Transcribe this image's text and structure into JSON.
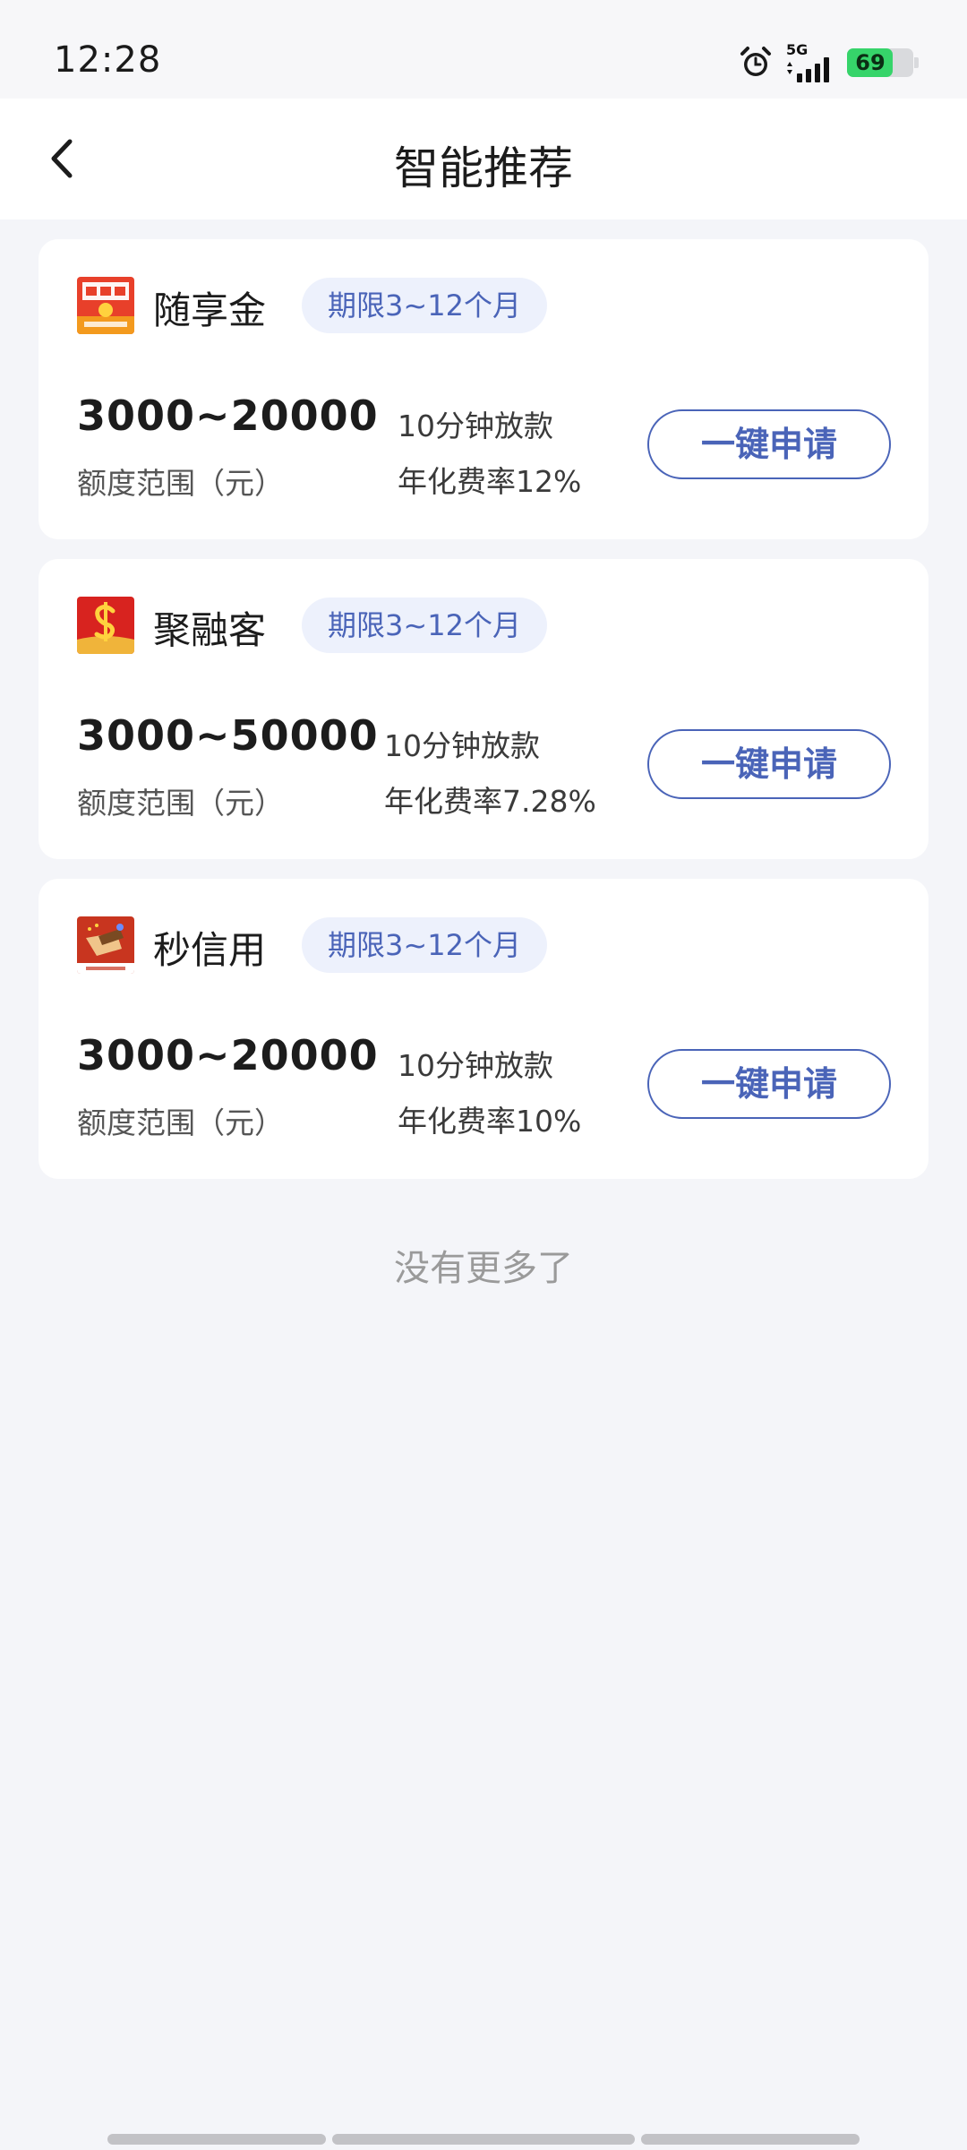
{
  "status_bar": {
    "time": "12:28",
    "network": "5G",
    "battery": "69",
    "battery_level": 0.69,
    "icons": [
      "alarm-icon",
      "signal-icon",
      "battery-icon"
    ]
  },
  "header": {
    "title": "智能推荐",
    "back_icon": "chevron-left-icon"
  },
  "products": [
    {
      "name": "随享金",
      "term": "期限3~12个月",
      "amount_range": "3000~20000",
      "amount_label": "额度范围（元）",
      "feature_1": "10分钟放款",
      "feature_2": "年化费率12%",
      "apply_label": "一键申请",
      "logo": "suixiangjin-logo"
    },
    {
      "name": "聚融客",
      "term": "期限3~12个月",
      "amount_range": "3000~50000",
      "amount_label": "额度范围（元）",
      "feature_1": "10分钟放款",
      "feature_2": "年化费率7.28%",
      "apply_label": "一键申请",
      "logo": "jurongke-logo"
    },
    {
      "name": "秒信用",
      "term": "期限3~12个月",
      "amount_range": "3000~20000",
      "amount_label": "额度范围（元）",
      "feature_1": "10分钟放款",
      "feature_2": "年化费率10%",
      "apply_label": "一键申请",
      "logo": "miaoxinyong-logo"
    }
  ],
  "footer_text": "没有更多了",
  "colors": {
    "accent": "#4a64b8",
    "badge_bg": "#edf1fc",
    "page_bg": "#f4f5f9",
    "battery_green": "#36d46a"
  }
}
